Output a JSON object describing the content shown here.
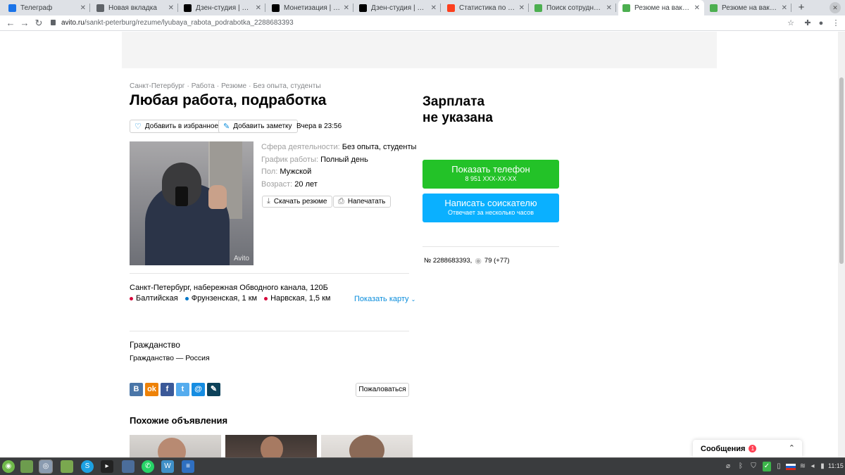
{
  "browser": {
    "tabs": [
      {
        "title": "Телеграф",
        "favicon_color": "#1a73e8",
        "active": false
      },
      {
        "title": "Новая вкладка",
        "favicon_color": "#5f6368",
        "active": false
      },
      {
        "title": "Дзен-студия | Мама в",
        "favicon_color": "#000000",
        "active": false
      },
      {
        "title": "Монетизация | Яндек",
        "favicon_color": "#000000",
        "active": false
      },
      {
        "title": "Дзен-студия | Работа,",
        "favicon_color": "#000000",
        "active": false
      },
      {
        "title": "Статистика по доходу",
        "favicon_color": "#fc3f1d",
        "active": false
      },
      {
        "title": "Поиск сотрудников в",
        "favicon_color": "#4caf50",
        "active": false
      },
      {
        "title": "Резюме на вакансию",
        "favicon_color": "#4caf50",
        "active": true
      },
      {
        "title": "Резюме на вакансию",
        "favicon_color": "#4caf50",
        "active": false
      }
    ],
    "new_tab": "+",
    "url_host": "avito.ru",
    "url_path": "/sankt-peterburg/rezume/lyubaya_rabota_podrabotka_2288683393"
  },
  "breadcrumb": [
    "Санкт-Петербург",
    "Работа",
    "Резюме",
    "Без опыта, студенты"
  ],
  "title": "Любая работа, подработка",
  "actions": {
    "favorite": "Добавить в избранное",
    "note": "Добавить заметку",
    "date": "Вчера в 23:56"
  },
  "photo": {
    "watermark": "Avito"
  },
  "properties": [
    {
      "label": "Сфера деятельности:",
      "value": "Без опыта, студенты"
    },
    {
      "label": "График работы:",
      "value": "Полный день"
    },
    {
      "label": "Пол:",
      "value": "Мужской"
    },
    {
      "label": "Возраст:",
      "value": "20 лет"
    }
  ],
  "doc_actions": {
    "download": "Скачать резюме",
    "print": "Напечатать"
  },
  "location": {
    "address": "Санкт-Петербург, набережная Обводного канала, 120Б",
    "metro": [
      {
        "name": "Балтийская",
        "distance": "",
        "color": "#d6083b"
      },
      {
        "name": "Фрунзенская",
        "distance": ", 1 км",
        "color": "#0078c9"
      },
      {
        "name": "Нарвская",
        "distance": ", 1,5 км",
        "color": "#d6083b"
      }
    ],
    "show_map": "Показать карту"
  },
  "citizenship": {
    "heading": "Гражданство",
    "text": "Гражданство — Россия"
  },
  "share": [
    {
      "name": "vk",
      "glyph": "B",
      "color": "#4a76a8"
    },
    {
      "name": "odnoklassniki",
      "glyph": "ok",
      "color": "#ee8208"
    },
    {
      "name": "facebook",
      "glyph": "f",
      "color": "#3b5998"
    },
    {
      "name": "twitter",
      "glyph": "t",
      "color": "#55acee"
    },
    {
      "name": "mail",
      "glyph": "@",
      "color": "#168de2"
    },
    {
      "name": "livejournal",
      "glyph": "✎",
      "color": "#0d425a"
    }
  ],
  "complain": "Пожаловаться",
  "similar_heading": "Похожие объявления",
  "salary": {
    "line1": "Зарплата",
    "line2": "не указана"
  },
  "phone_button": {
    "label": "Показать телефон",
    "number": "8 951 XXX-XX-XX",
    "color": "#23c228"
  },
  "message_button": {
    "label": "Написать соискателю",
    "sub": "Отвечает за несколько часов",
    "color": "#0ab0ff"
  },
  "meta": {
    "id": "№ 2288683393,",
    "views": "79 (+77)"
  },
  "messages_widget": {
    "label": "Сообщения",
    "count": "1"
  },
  "taskbar": {
    "clock": "11:15"
  }
}
